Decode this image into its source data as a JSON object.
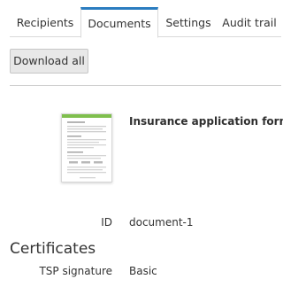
{
  "tabs": [
    {
      "label": "Recipients",
      "active": false
    },
    {
      "label": "Documents",
      "active": true
    },
    {
      "label": "Settings",
      "active": false
    },
    {
      "label": "Audit trail",
      "active": false
    }
  ],
  "toolbar": {
    "download_all_label": "Download all"
  },
  "document": {
    "title": "Insurance application form",
    "id_label": "ID",
    "id_value": "document-1",
    "thumbnail_icon": "document-thumbnail"
  },
  "certificates": {
    "heading": "Certificates",
    "rows": [
      {
        "label": "TSP signature",
        "value": "Basic"
      }
    ]
  },
  "colors": {
    "active_tab_accent": "#2b7dc0",
    "thumbnail_header": "#7fbf4d"
  }
}
